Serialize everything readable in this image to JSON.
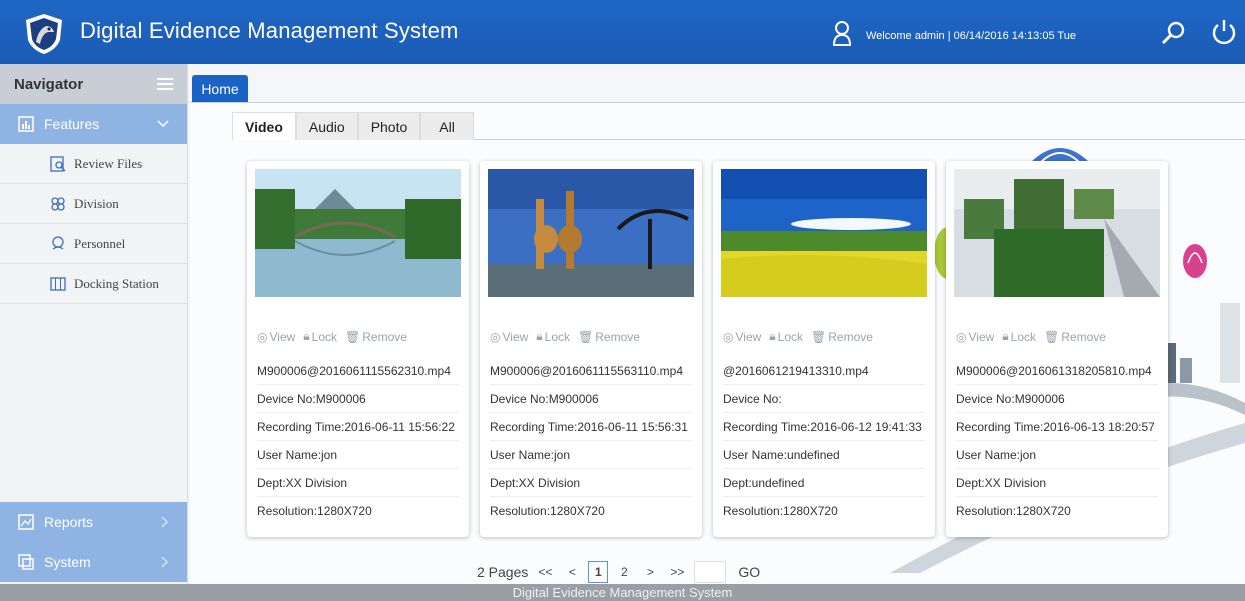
{
  "header": {
    "title": "Digital Evidence Management System",
    "welcome": "Welcome admin | 06/14/2016 14:13:05 Tue",
    "icons": [
      "shield-logo-icon",
      "user-icon",
      "search-icon",
      "power-icon"
    ]
  },
  "sidebar": {
    "navigator_label": "Navigator",
    "features_label": "Features",
    "items": [
      {
        "label": "Review Files",
        "icon": "review-files-icon"
      },
      {
        "label": "Division",
        "icon": "division-icon"
      },
      {
        "label": "Personnel",
        "icon": "personnel-icon"
      },
      {
        "label": "Docking Station",
        "icon": "docking-station-icon"
      }
    ],
    "reports_label": "Reports",
    "system_label": "System"
  },
  "main": {
    "home_tab": "Home",
    "media_tabs": [
      "Video",
      "Audio",
      "Photo",
      "All"
    ],
    "active_tab": "Video",
    "actions": {
      "view": "View",
      "lock": "Lock",
      "remove": "Remove"
    },
    "cards": [
      {
        "file": "M900006@2016061115562310.mp4",
        "device": "Device No:M900006",
        "time": "Recording Time:2016-06-11 15:56:22",
        "user": "User Name:jon",
        "dept": "Dept:XX Division",
        "resolution": "Resolution:1280X720"
      },
      {
        "file": "M900006@2016061115563110.mp4",
        "device": "Device No:M900006",
        "time": "Recording Time:2016-06-11 15:56:31",
        "user": "User Name:jon",
        "dept": "Dept:XX Division",
        "resolution": "Resolution:1280X720"
      },
      {
        "file": "@2016061219413310.mp4",
        "device": "Device No:",
        "time": "Recording Time:2016-06-12 19:41:33",
        "user": "User Name:undefined",
        "dept": "Dept:undefined",
        "resolution": "Resolution:1280X720"
      },
      {
        "file": "M900006@2016061318205810.mp4",
        "device": "Device No:M900006",
        "time": "Recording Time:2016-06-13 18:20:57",
        "user": "User Name:jon",
        "dept": "Dept:XX Division",
        "resolution": "Resolution:1280X720"
      }
    ]
  },
  "pager": {
    "pages_label": "2 Pages",
    "first": "<<",
    "prev": "<",
    "pages": [
      "1",
      "2"
    ],
    "current": "1",
    "next": ">",
    "last": ">>",
    "go_label": "GO"
  },
  "footer": {
    "text": "Digital Evidence Management System"
  },
  "colors": {
    "header_blue": "#1a5bb5",
    "sidebar_accent": "#8fb3e3",
    "footer_gray": "#9a9fa6"
  }
}
